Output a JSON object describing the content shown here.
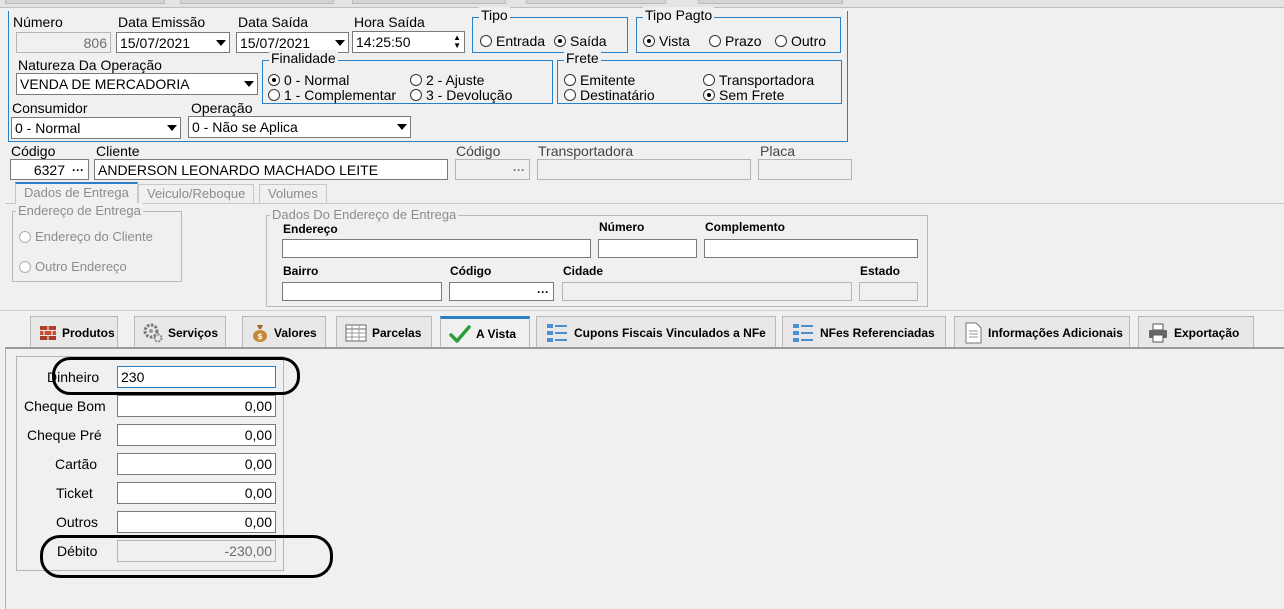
{
  "header": {
    "numero": {
      "label": "Número",
      "value": "806"
    },
    "data_emissao": {
      "label": "Data Emissão",
      "value": "15/07/2021"
    },
    "data_saida": {
      "label": "Data Saída",
      "value": "15/07/2021"
    },
    "hora_saida": {
      "label": "Hora Saída",
      "value": "14:25:50"
    },
    "tipo": {
      "title": "Tipo",
      "options": [
        "Entrada",
        "Saída"
      ],
      "selected": "Saída"
    },
    "tipo_pagto": {
      "title": "Tipo Pagto",
      "options": [
        "Vista",
        "Prazo",
        "Outro"
      ],
      "selected": "Vista"
    },
    "natureza": {
      "label": "Natureza Da Operação",
      "value": "VENDA DE MERCADORIA"
    },
    "finalidade": {
      "title": "Finalidade",
      "options": [
        "0 - Normal",
        "2 - Ajuste",
        "1 - Complementar",
        "3 - Devolução"
      ],
      "selected": "0 - Normal"
    },
    "frete": {
      "title": "Frete",
      "options": [
        "Emitente",
        "Transportadora",
        "Destinatário",
        "Sem Frete"
      ],
      "selected": "Sem Frete"
    },
    "consumidor": {
      "label": "Consumidor",
      "value": "0 - Normal"
    },
    "operacao": {
      "label": "Operação",
      "value": "0 - Não se Aplica"
    }
  },
  "cliente_row": {
    "codigo_label": "Código",
    "codigo_value": "6327",
    "cliente_label": "Cliente",
    "cliente_value": "ANDERSON LEONARDO MACHADO LEITE",
    "codigo_transp_label": "Código",
    "transportadora_label": "Transportadora",
    "placa_label": "Placa"
  },
  "entrega_tabs": [
    "Dados de Entrega",
    "Veiculo/Reboque",
    "Volumes"
  ],
  "entrega": {
    "endereco_group_title": "Endereço de Entrega",
    "options": [
      "Endereço do Cliente",
      "Outro Endereço"
    ],
    "dados_group_title": "Dados Do Endereço de Entrega",
    "fields": {
      "endereco": "Endereço",
      "numero": "Número",
      "complemento": "Complemento",
      "bairro": "Bairro",
      "codigo": "Código",
      "cidade": "Cidade",
      "estado": "Estado"
    }
  },
  "main_tabs": [
    {
      "label": "Produtos",
      "icon": "bricks-icon"
    },
    {
      "label": "Serviços",
      "icon": "gears-icon"
    },
    {
      "label": "Valores",
      "icon": "money-bag-icon"
    },
    {
      "label": "Parcelas",
      "icon": "grid-icon"
    },
    {
      "label": "A Vista",
      "icon": "checkmark-icon"
    },
    {
      "label": "Cupons Fiscais Vinculados a NFe",
      "icon": "list-icon"
    },
    {
      "label": "NFes Referenciadas",
      "icon": "list-icon"
    },
    {
      "label": "Informações Adicionais",
      "icon": "document-icon"
    },
    {
      "label": "Exportação",
      "icon": "printer-icon"
    }
  ],
  "active_tab": "A Vista",
  "a_vista": {
    "dinheiro": {
      "label": "Dinheiro",
      "value": "230"
    },
    "cheque_bom": {
      "label": "Cheque Bom",
      "value": "0,00"
    },
    "cheque_pre": {
      "label": "Cheque Pré",
      "value": "0,00"
    },
    "cartao": {
      "label": "Cartão",
      "value": "0,00"
    },
    "ticket": {
      "label": "Ticket",
      "value": "0,00"
    },
    "outros": {
      "label": "Outros",
      "value": "0,00"
    },
    "debito": {
      "label": "Débito",
      "value": "-230,00"
    }
  },
  "colors": {
    "accent": "#2b7fc6",
    "annotation": "#000000"
  }
}
